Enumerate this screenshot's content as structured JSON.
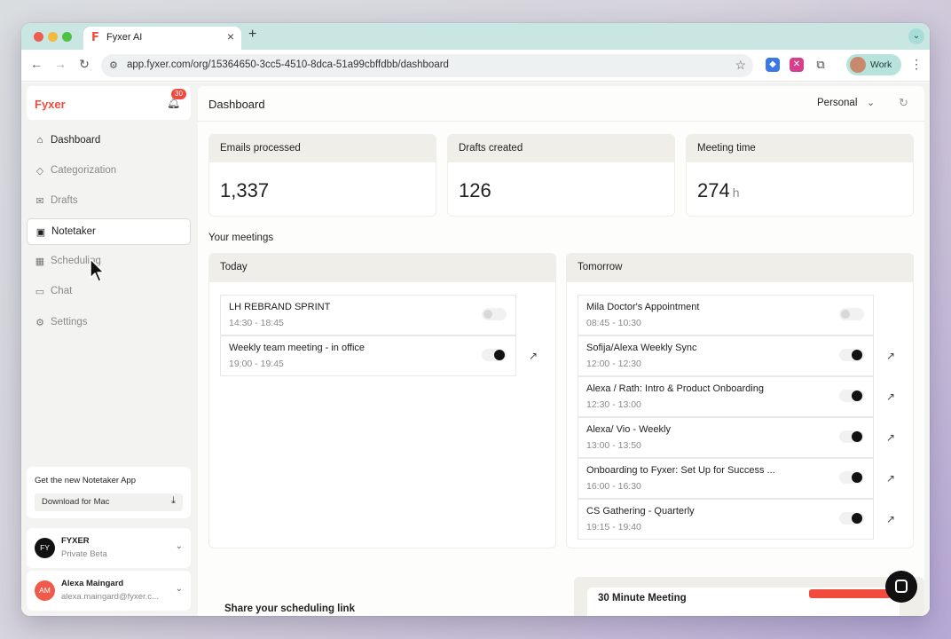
{
  "browser": {
    "tab_title": "Fyxer AI",
    "tab_favicon": "F",
    "tab_close": "×",
    "new_tab": "+",
    "url": "app.fyxer.com/org/15364650-3cc5-4510-8dca-51a99cbffdbb/dashboard",
    "profile_label": "Work",
    "icons": [
      "back-icon",
      "forward-icon",
      "reload-icon",
      "site-settings-icon",
      "bookmark-star-icon",
      "extensions-icon",
      "menu-icon"
    ]
  },
  "sidebar": {
    "logo": "Fyxer",
    "notification_count": "30",
    "items": [
      {
        "label": "Dashboard",
        "icon": "home-icon"
      },
      {
        "label": "Categorization",
        "icon": "tag-icon"
      },
      {
        "label": "Drafts",
        "icon": "mail-icon"
      },
      {
        "label": "Notetaker",
        "icon": "notetaker-icon"
      },
      {
        "label": "Scheduling",
        "icon": "calendar-icon"
      },
      {
        "label": "Chat",
        "icon": "chat-icon"
      },
      {
        "label": "Settings",
        "icon": "gear-icon"
      }
    ],
    "promo": {
      "title": "Get the new Notetaker App",
      "button": "Download for Mac"
    },
    "org": {
      "initials": "FY",
      "name": "FYXER",
      "subtitle": "Private Beta"
    },
    "user": {
      "initials": "AM",
      "name": "Alexa Maingard",
      "email": "alexa.maingard@fyxer.c..."
    }
  },
  "main": {
    "title": "Dashboard",
    "view_selector": "Personal",
    "stats": [
      {
        "label": "Emails processed",
        "value": "1,337",
        "unit": ""
      },
      {
        "label": "Drafts created",
        "value": "126",
        "unit": ""
      },
      {
        "label": "Meeting time",
        "value": "274",
        "unit": "h"
      }
    ],
    "meetings_title": "Your meetings",
    "today": {
      "label": "Today",
      "meetings": [
        {
          "title": "LH REBRAND SPRINT",
          "time": "14:30 - 18:45",
          "enabled": false
        },
        {
          "title": "Weekly team meeting - in office",
          "time": "19:00 - 19:45",
          "enabled": true
        }
      ]
    },
    "tomorrow": {
      "label": "Tomorrow",
      "meetings": [
        {
          "title": "Mila Doctor's Appointment",
          "time": "08:45 - 10:30",
          "enabled": false
        },
        {
          "title": "Sofija/Alexa Weekly Sync",
          "time": "12:00 - 12:30",
          "enabled": true
        },
        {
          "title": "Alexa / Rath: Intro & Product Onboarding",
          "time": "12:30 - 13:00",
          "enabled": true
        },
        {
          "title": "Alexa/ Vio - Weekly",
          "time": "13:00 - 13:50",
          "enabled": true
        },
        {
          "title": "Onboarding to Fyxer: Set Up for Success ...",
          "time": "16:00 - 16:30",
          "enabled": true
        },
        {
          "title": "CS Gathering - Quarterly",
          "time": "19:15 - 19:40",
          "enabled": true
        }
      ]
    },
    "scheduling": {
      "share_title": "Share your scheduling link",
      "meeting_title": "30 Minute Meeting"
    }
  },
  "colors": {
    "brand": "#f04b3c",
    "tab_strip": "#c9e6e3",
    "panel_header": "#efeee9"
  }
}
